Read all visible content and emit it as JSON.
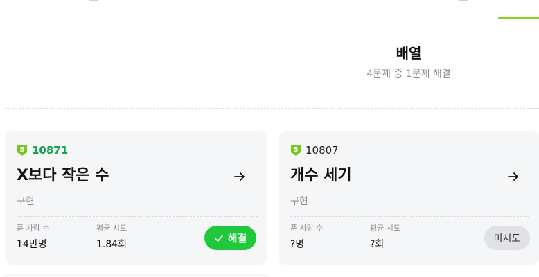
{
  "section": {
    "title": "배열",
    "progress": "4문제 중 1문제 해결"
  },
  "colors": {
    "accent": "#8bd11f",
    "solved_green": "#1fc93b",
    "level_badge": "#7cc324",
    "card_bg": "#f5f6f8"
  },
  "cards": [
    {
      "level": "5",
      "id": "10871",
      "title": "X보다 작은 수",
      "category": "구현",
      "solvers_label": "푼 사람 수",
      "solvers_value": "14만명",
      "tries_label": "평균 시도",
      "tries_value": "1.84회",
      "status_label": "해결",
      "status_icon": "check-icon",
      "link_icon": "arrow-right-icon"
    },
    {
      "level": "5",
      "id": "10807",
      "title": "개수 세기",
      "category": "구현",
      "solvers_label": "푼 사람 수",
      "solvers_value": "?명",
      "tries_label": "평균 시도",
      "tries_value": "?회",
      "status_label": "미시도",
      "link_icon": "arrow-right-icon"
    }
  ]
}
